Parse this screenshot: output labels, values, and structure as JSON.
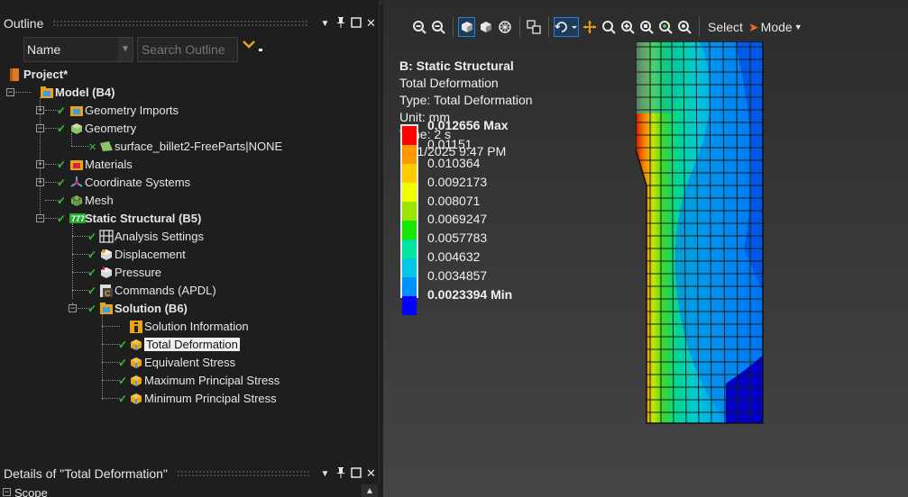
{
  "outline": {
    "title": "Outline",
    "name_filter": "Name",
    "search_placeholder": "Search Outline",
    "tree": [
      {
        "label": "Project*",
        "bold": true
      },
      {
        "label": "Model (B4)",
        "bold": true
      },
      {
        "label": "Geometry Imports"
      },
      {
        "label": "Geometry"
      },
      {
        "label": "surface_billet2-FreeParts|NONE"
      },
      {
        "label": "Materials"
      },
      {
        "label": "Coordinate Systems"
      },
      {
        "label": "Mesh"
      },
      {
        "label": "Static Structural (B5)",
        "bold": true
      },
      {
        "label": "Analysis Settings"
      },
      {
        "label": "Displacement"
      },
      {
        "label": "Pressure"
      },
      {
        "label": "Commands (APDL)"
      },
      {
        "label": "Solution (B6)",
        "bold": true
      },
      {
        "label": "Solution Information"
      },
      {
        "label": "Total Deformation",
        "selected": true
      },
      {
        "label": "Equivalent Stress"
      },
      {
        "label": "Maximum Principal Stress"
      },
      {
        "label": "Minimum Principal Stress"
      }
    ]
  },
  "details": {
    "title": "Details of \"Total Deformation\"",
    "first_row": "Scope"
  },
  "toolbar": {
    "select_label": "Select",
    "mode_label": "Mode"
  },
  "result": {
    "header": "B: Static Structural",
    "lines": [
      "Total Deformation",
      "Type: Total Deformation",
      "Unit: mm",
      "Time: 2 s",
      "1/21/2025 9:47 PM"
    ],
    "legend_values": [
      "0.012656 Max",
      "0.01151",
      "0.010364",
      "0.0092173",
      "0.008071",
      "0.0069247",
      "0.0057783",
      "0.004632",
      "0.0034857",
      "0.0023394 Min"
    ],
    "legend_colors": [
      "#ff0000",
      "#ff9900",
      "#ffcc00",
      "#eeff00",
      "#9be600",
      "#19e600",
      "#00e6a0",
      "#00c8e6",
      "#0090ff",
      "#0000ff"
    ]
  }
}
